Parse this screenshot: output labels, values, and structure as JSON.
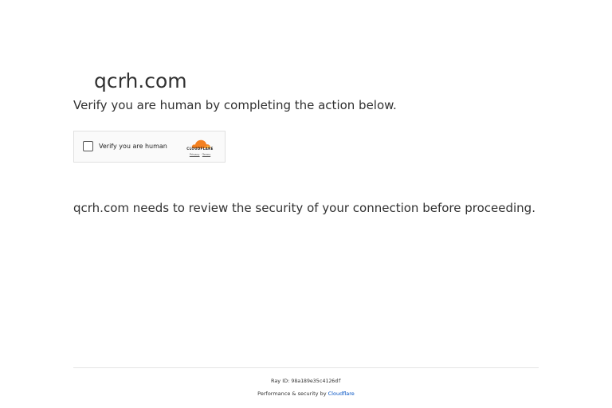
{
  "site": {
    "title": "qcrh.com"
  },
  "challenge": {
    "instruction": "Verify you are human by completing the action below.",
    "checkbox_label": "Verify you are human",
    "provider_wordmark": "CLOUDFLARE",
    "privacy_link": "Privacy",
    "separator": " · ",
    "terms_link": "Terms",
    "brand_color": "#f38020"
  },
  "message": {
    "security_text": "qcrh.com needs to review the security of your connection before proceeding."
  },
  "footer": {
    "ray_id_label": "Ray ID: ",
    "ray_id_value": "98a189e35c4126df",
    "performance_prefix": "Performance & security by ",
    "performance_link": "Cloudflare",
    "link_color": "#0051c3"
  }
}
